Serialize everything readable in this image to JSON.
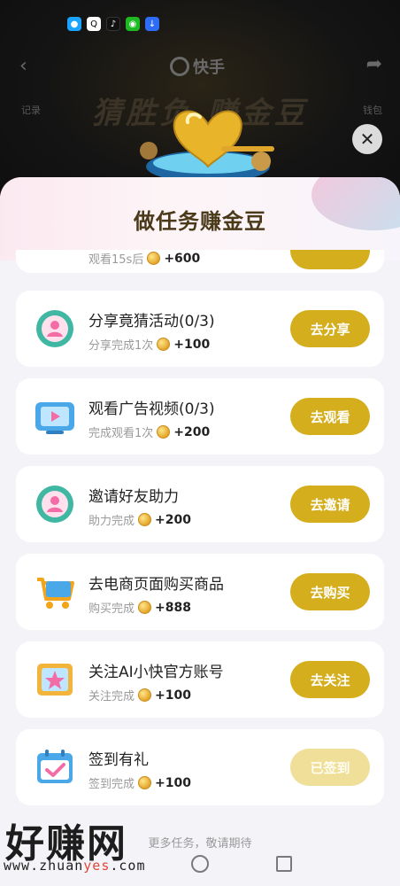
{
  "top": {
    "brand": "快手",
    "game_title": "猜胜负 赚金豆",
    "left_link": "记录",
    "right_link": "钱包"
  },
  "sheet": {
    "title": "做任务赚金豆"
  },
  "tasks": [
    {
      "title": "",
      "subtitle": "观看15s后",
      "reward": "+600",
      "button": "",
      "done": false
    },
    {
      "title": "分享竟猜活动(0/3)",
      "subtitle": "分享完成1次",
      "reward": "+100",
      "button": "去分享",
      "icon": "avatar-badge-icon",
      "done": false
    },
    {
      "title": "观看广告视频(0/3)",
      "subtitle": "完成观看1次",
      "reward": "+200",
      "button": "去观看",
      "icon": "tv-play-icon",
      "done": false
    },
    {
      "title": "邀请好友助力",
      "subtitle": "助力完成",
      "reward": "+200",
      "button": "去邀请",
      "icon": "avatar-badge-icon",
      "done": false
    },
    {
      "title": "去电商页面购买商品",
      "subtitle": "购买完成",
      "reward": "+888",
      "button": "去购买",
      "icon": "shopping-cart-icon",
      "done": false
    },
    {
      "title": "关注AI小快官方账号",
      "subtitle": "关注完成",
      "reward": "+100",
      "button": "去关注",
      "icon": "star-frame-icon",
      "done": false
    },
    {
      "title": "签到有礼",
      "subtitle": "签到完成",
      "reward": "+100",
      "button": "已签到",
      "icon": "calendar-check-icon",
      "done": true
    }
  ],
  "footer": {
    "text": "更多任务，敬请期待"
  },
  "watermark": {
    "title": "好赚网",
    "url_pre": "www.zhuan",
    "url_hl": "yes",
    "url_post": ".com"
  },
  "colors": {
    "button": "#d4ae1c",
    "button_done": "#efdf98",
    "sheet_bg": "#f4f4f8"
  }
}
